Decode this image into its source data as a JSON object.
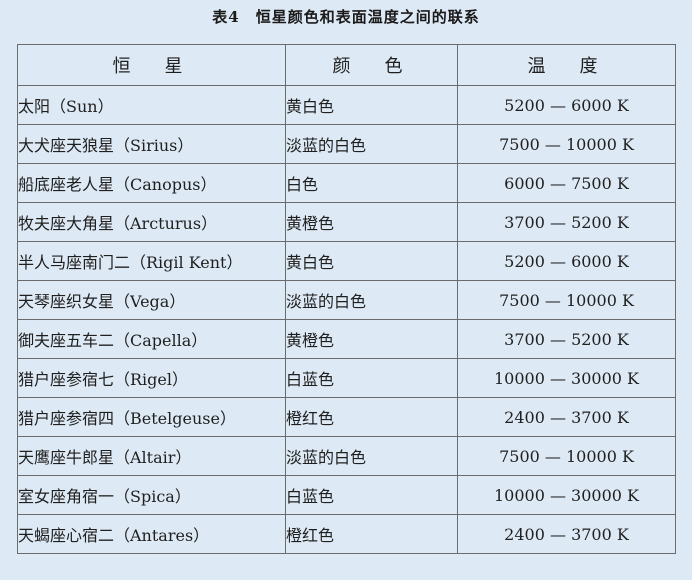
{
  "caption": "表4　恒星颜色和表面温度之间的联系",
  "headers": [
    "恒　星",
    "颜　色",
    "温　度"
  ],
  "rows": [
    {
      "star": "太阳（Sun）",
      "color": "黄白色",
      "temp": "5200 — 6000 K"
    },
    {
      "star": "大犬座天狼星（Sirius）",
      "color": "淡蓝的白色",
      "temp": "7500 — 10000 K"
    },
    {
      "star": "船底座老人星（Canopus）",
      "color": "白色",
      "temp": "6000 — 7500 K"
    },
    {
      "star": "牧夫座大角星（Arcturus）",
      "color": "黄橙色",
      "temp": "3700 — 5200 K"
    },
    {
      "star": "半人马座南门二（Rigil Kent）",
      "color": "黄白色",
      "temp": "5200 — 6000 K"
    },
    {
      "star": "天琴座织女星（Vega）",
      "color": "淡蓝的白色",
      "temp": "7500 — 10000 K"
    },
    {
      "star": "御夫座五车二（Capella）",
      "color": "黄橙色",
      "temp": "3700 — 5200 K"
    },
    {
      "star": "猎户座参宿七（Rigel）",
      "color": "白蓝色",
      "temp": "10000 — 30000 K"
    },
    {
      "star": "猎户座参宿四（Betelgeuse）",
      "color": "橙红色",
      "temp": "2400 — 3700 K"
    },
    {
      "star": "天鹰座牛郎星（Altair）",
      "color": "淡蓝的白色",
      "temp": "7500 — 10000 K"
    },
    {
      "star": "室女座角宿一（Spica）",
      "color": "白蓝色",
      "temp": "10000 — 30000 K"
    },
    {
      "star": "天蝎座心宿二（Antares）",
      "color": "橙红色",
      "temp": "2400 — 3700 K"
    }
  ]
}
